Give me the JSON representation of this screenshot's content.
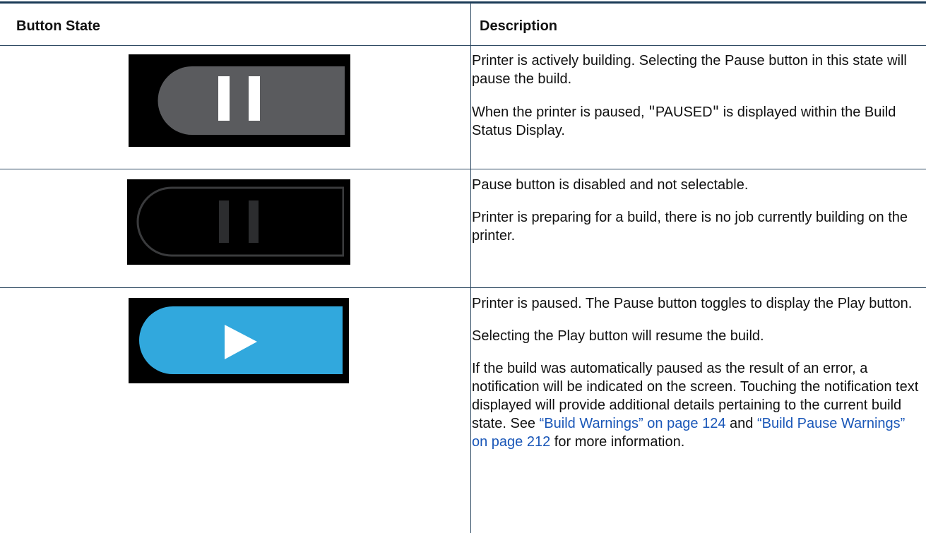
{
  "table": {
    "headers": {
      "button_state": "Button State",
      "description": "Description"
    },
    "rows": [
      {
        "state_image": "pause-button-active",
        "description": {
          "p1": "Printer is actively building. Selecting the Pause button in this state will pause the build.",
          "p2_before": "When the printer is paused, ",
          "p2_quote_open": "\"",
          "p2_quoted": "PAUSED",
          "p2_quote_close": "\"",
          "p2_after": " is displayed within the Build Status Display."
        }
      },
      {
        "state_image": "pause-button-disabled",
        "description": {
          "p1": "Pause button is disabled and not selectable.",
          "p2": "Printer is preparing for a build, there is no job currently building on the printer."
        }
      },
      {
        "state_image": "play-button",
        "description": {
          "p1": "Printer is paused. The Pause button toggles to display the Play button.",
          "p2": "Selecting the Play button will resume the build.",
          "p3_text1": "If the build was automatically paused as the result of an error, a notification will be indicated on the screen. Touching the notification text displayed will provide additional details pertaining to the current build state. See ",
          "p3_link1": "“Build Warnings” on page 124",
          "p3_text2": " and ",
          "p3_link2": "“Build Pause Warnings” on page 212",
          "p3_text3": " for more information."
        }
      }
    ]
  },
  "colors": {
    "rule": "#1a3a56",
    "link": "#1a57b8",
    "pause_active_fill": "#5a5b5e",
    "pause_disabled_outline": "#3a3b3d",
    "play_fill": "#31a8dd"
  }
}
